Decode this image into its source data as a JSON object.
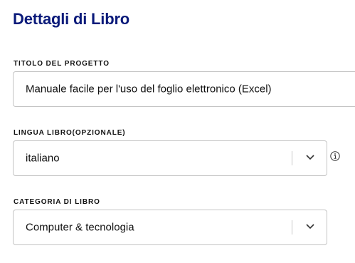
{
  "page": {
    "title": "Dettagli di Libro"
  },
  "project_title": {
    "label": "TITOLO DEL PROGETTO",
    "value": "Manuale facile per l'uso del foglio elettronico (Excel)"
  },
  "book_language": {
    "label": "LINGUA LIBRO(OPZIONALE)",
    "value": "italiano",
    "icons": [
      "chevron-down-icon",
      "info-icon"
    ]
  },
  "book_category": {
    "label": "CATEGORIA DI LIBRO",
    "value": "Computer & tecnologia",
    "icons": [
      "chevron-down-icon"
    ]
  },
  "colors": {
    "title": "#0a1a7a",
    "text": "#111111",
    "border": "#c4c4c4"
  }
}
